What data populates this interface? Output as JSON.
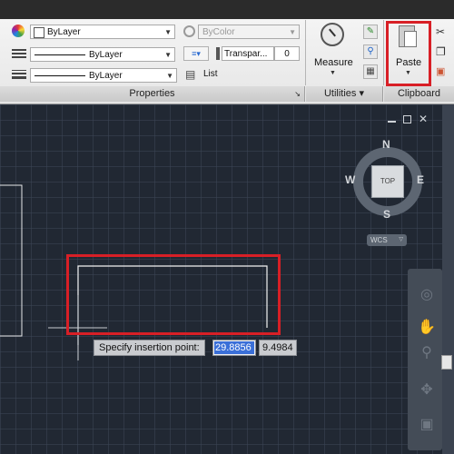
{
  "properties": {
    "color_value": "ByLayer",
    "linetype_value": "ByLayer",
    "lineweight_value": "ByLayer",
    "plotstyle_value": "ByColor",
    "transparency_label": "Transpar...",
    "transparency_value": "0",
    "list_label": "List",
    "panel_label": "Properties"
  },
  "utilities": {
    "measure_label": "Measure",
    "panel_label": "Utilities",
    "panel_arrow": "▾"
  },
  "clipboard": {
    "paste_label": "Paste",
    "panel_label": "Clipboard"
  },
  "viewcube": {
    "north": "N",
    "south": "S",
    "east": "E",
    "west": "W",
    "face": "TOP",
    "ucs": "WCS"
  },
  "prompt": {
    "label": "Specify insertion point:",
    "x_value": "29.8856",
    "y_value": "9.4984"
  },
  "colors": {
    "highlight": "#d81f26",
    "canvas": "#212833",
    "input_selected": "#3a6fd8"
  }
}
